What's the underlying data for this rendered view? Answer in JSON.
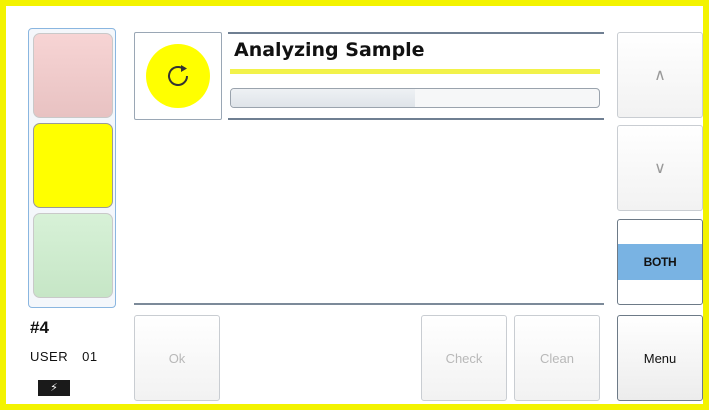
{
  "device": {
    "unit_number": "#4",
    "user_label": "USER",
    "user_id": "01",
    "battery_glyph": "⚡",
    "frame_color": "#f3f300"
  },
  "status_lights": [
    {
      "name": "red",
      "active": false,
      "color": "#e8c2c2"
    },
    {
      "name": "yellow",
      "active": true,
      "color": "#ffff00"
    },
    {
      "name": "green",
      "active": false,
      "color": "#c6e6c6"
    }
  ],
  "status": {
    "title": "Analyzing Sample",
    "icon": "refresh-icon",
    "progress": 0.5
  },
  "buttons": {
    "up": "∧",
    "down": "∨",
    "both": "BOTH",
    "ok": "Ok",
    "check": "Check",
    "clean": "Clean",
    "menu": "Menu"
  }
}
